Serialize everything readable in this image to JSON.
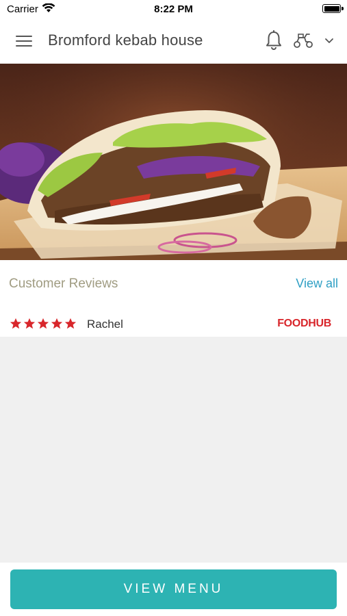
{
  "status_bar": {
    "carrier": "Carrier",
    "time": "8:22 PM"
  },
  "header": {
    "title": "Bromford kebab house"
  },
  "hero": {
    "image_subject": "doner kebab in pitta bread"
  },
  "reviews": {
    "title": "Customer Reviews",
    "view_all": "View all",
    "items": [
      {
        "rating": 5,
        "max_rating": 5,
        "name": "Rachel",
        "source": "FOODHUB"
      }
    ]
  },
  "footer": {
    "button_label": "VIEW MENU"
  },
  "colors": {
    "accent": "#2db3b3",
    "link": "#2f9fc4",
    "star": "#d8262b",
    "reviews_title": "#a09c82"
  }
}
